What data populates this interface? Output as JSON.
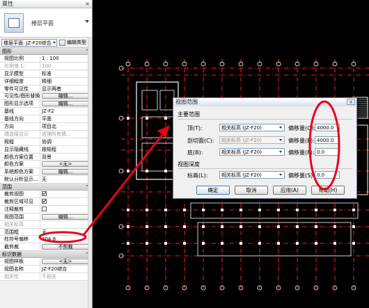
{
  "properties": {
    "title": "属性",
    "close_glyph": "×",
    "type_name": "楼层平面",
    "type_selector": "楼层平面: JZ-F20综合",
    "edit_type": "编辑类型",
    "groups": {
      "graphics": "图形",
      "extents": "范围",
      "identity": "标识数据"
    },
    "graphics_rows": [
      {
        "name": "视图比例",
        "value": "1 : 100",
        "kind": "text"
      },
      {
        "name": "比例值 1:",
        "value": "100",
        "kind": "disabled"
      },
      {
        "name": "显示模型",
        "value": "标准",
        "kind": "text"
      },
      {
        "name": "详细程度",
        "value": "精细",
        "kind": "text"
      },
      {
        "name": "零件可见性",
        "value": "显示两者",
        "kind": "text"
      },
      {
        "name": "可见性/图形替换",
        "value": "编辑...",
        "kind": "button"
      },
      {
        "name": "图形显示选项",
        "value": "编辑...",
        "kind": "button"
      },
      {
        "name": "基线",
        "value": "JZ-F2",
        "kind": "text"
      },
      {
        "name": "基线方向",
        "value": "平面",
        "kind": "text"
      },
      {
        "name": "方向",
        "value": "项目北",
        "kind": "text"
      },
      {
        "name": "墙连接显示",
        "value": "清理所有墙...",
        "kind": "disabled"
      },
      {
        "name": "规程",
        "value": "协调",
        "kind": "text"
      },
      {
        "name": "显示隐藏线",
        "value": "按规程",
        "kind": "text"
      },
      {
        "name": "颜色方案位置",
        "value": "背景",
        "kind": "text"
      },
      {
        "name": "颜色方案",
        "value": "<无>",
        "kind": "button"
      },
      {
        "name": "系统颜色方案",
        "value": "编辑...",
        "kind": "button"
      },
      {
        "name": "默认分析显示...",
        "value": "无",
        "kind": "text"
      }
    ],
    "extents_rows": [
      {
        "name": "裁剪视图",
        "value": "",
        "kind": "checkbox",
        "checked": true
      },
      {
        "name": "裁剪区域可见",
        "value": "",
        "kind": "checkbox",
        "checked": true
      },
      {
        "name": "注释裁剪",
        "value": "",
        "kind": "checkbox",
        "checked": false
      },
      {
        "name": "视图范围",
        "value": "编辑...",
        "kind": "button"
      },
      {
        "name": "相关标高",
        "value": "",
        "kind": "disabled"
      },
      {
        "name": "范围框",
        "value": "无",
        "kind": "text"
      },
      {
        "name": "柱符号偏移",
        "value": "304.8",
        "kind": "text"
      },
      {
        "name": "截剪裁",
        "value": "不剪裁",
        "kind": "button"
      }
    ],
    "identity_rows": [
      {
        "name": "视图样板",
        "value": "<无>",
        "kind": "button"
      },
      {
        "name": "视图名称",
        "value": "JZ-F20综合",
        "kind": "text"
      },
      {
        "name": "相关性",
        "value": "不相关",
        "kind": "disabled"
      }
    ]
  },
  "dialog": {
    "title": "视图范围",
    "close_glyph": "×",
    "primary_range": "主要范围",
    "view_depth": "视图深度",
    "rows": [
      {
        "label": "顶(T):",
        "level": "相关标高 (JZ-F20)",
        "offset_label": "偏移量(O):",
        "offset": "4000.0",
        "disabled": false
      },
      {
        "label": "剖切面(C):",
        "level": "相关标高 (JZ-F20)",
        "offset_label": "偏移量(E):",
        "offset": "4000.0",
        "disabled": true
      },
      {
        "label": "底(B):",
        "level": "相关标高 (JZ-F20)",
        "offset_label": "偏移量(F):",
        "offset": "0.0",
        "disabled": false
      },
      {
        "label": "标高(L):",
        "level": "相关标高 (JZ-F20)",
        "offset_label": "偏移量(S):",
        "offset": "0.0",
        "disabled": false
      }
    ],
    "buttons": {
      "ok": "确定",
      "cancel": "取消",
      "apply": "应用(A)",
      "help": "帮助(H)"
    }
  },
  "annotations": {
    "color": "#e8001c"
  },
  "colors": {
    "canvas": "#000000",
    "grid": "#ff2020",
    "walls": "#ffffff",
    "accent": "#e8001c"
  }
}
